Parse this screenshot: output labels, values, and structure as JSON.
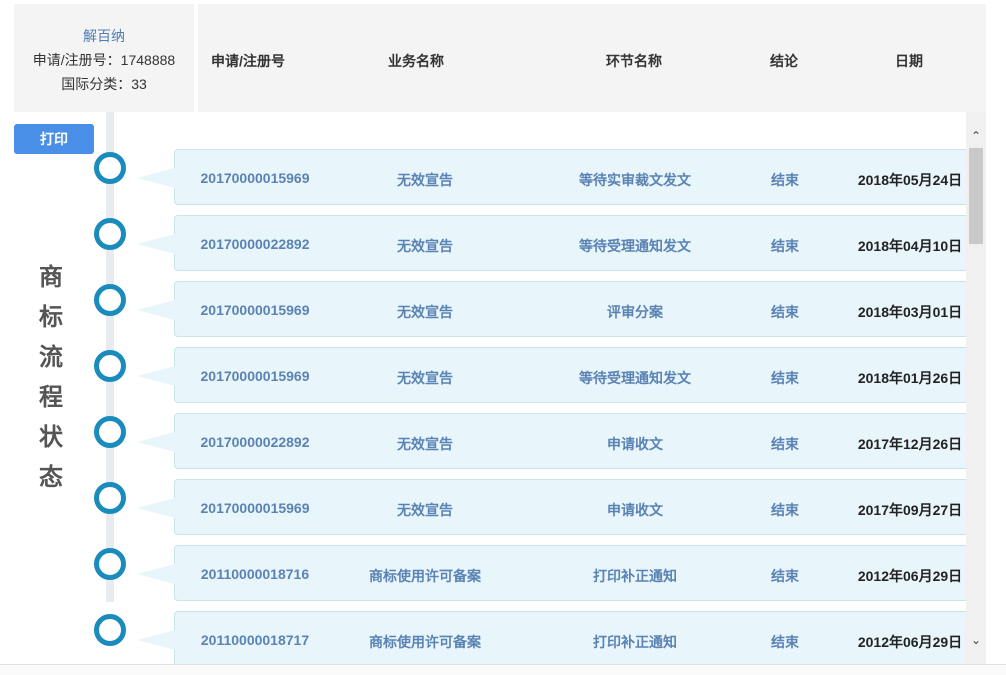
{
  "info": {
    "mark_name": "解百纳",
    "reg_line": "申请/注册号：1748888",
    "class_line": "国际分类：33"
  },
  "header": {
    "columns": [
      "申请/注册号",
      "业务名称",
      "环节名称",
      "结论",
      "日期"
    ]
  },
  "print_label": "打印",
  "side_title": [
    "商",
    "标",
    "流",
    "程",
    "状",
    "态"
  ],
  "rows": [
    {
      "reg": "20170000015969",
      "business": "无效宣告",
      "stage": "等待实审裁文发文",
      "result": "结束",
      "date": "2018年05月24日"
    },
    {
      "reg": "20170000022892",
      "business": "无效宣告",
      "stage": "等待受理通知发文",
      "result": "结束",
      "date": "2018年04月10日"
    },
    {
      "reg": "20170000015969",
      "business": "无效宣告",
      "stage": "评审分案",
      "result": "结束",
      "date": "2018年03月01日"
    },
    {
      "reg": "20170000015969",
      "business": "无效宣告",
      "stage": "等待受理通知发文",
      "result": "结束",
      "date": "2018年01月26日"
    },
    {
      "reg": "20170000022892",
      "business": "无效宣告",
      "stage": "申请收文",
      "result": "结束",
      "date": "2017年12月26日"
    },
    {
      "reg": "20170000015969",
      "business": "无效宣告",
      "stage": "申请收文",
      "result": "结束",
      "date": "2017年09月27日"
    },
    {
      "reg": "20110000018716",
      "business": "商标使用许可备案",
      "stage": "打印补正通知",
      "result": "结束",
      "date": "2012年06月29日"
    },
    {
      "reg": "20110000018717",
      "business": "商标使用许可备案",
      "stage": "打印补正通知",
      "result": "结束",
      "date": "2012年06月29日"
    }
  ],
  "scrollbar": {
    "up_icon": "chevron-up-icon",
    "down_icon": "chevron-down-icon"
  }
}
